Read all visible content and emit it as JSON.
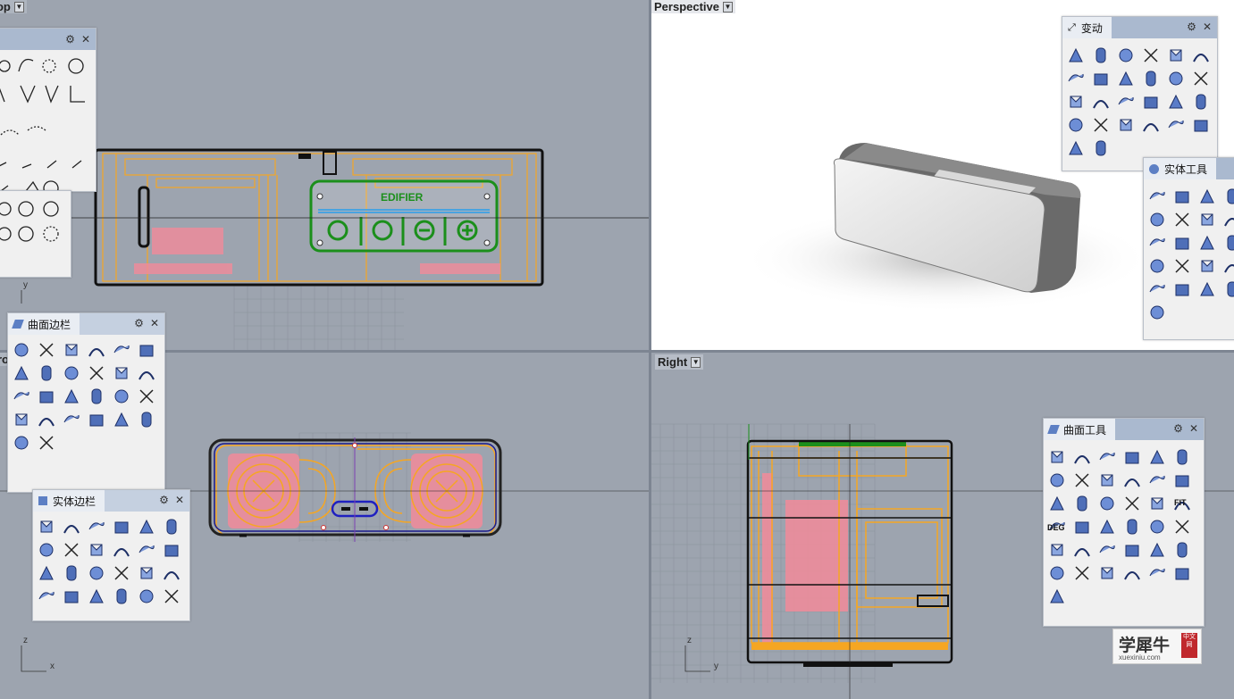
{
  "viewports": {
    "top": {
      "label": "Top"
    },
    "perspective": {
      "label": "Perspective"
    },
    "front": {
      "label": "Front"
    },
    "right": {
      "label": "Right"
    }
  },
  "axes": {
    "y": "y",
    "z": "z",
    "x": "x"
  },
  "model": {
    "brand_text": "EDIFIER"
  },
  "panels": {
    "transform": {
      "title": "变动"
    },
    "solid_tools": {
      "title": "实体工具"
    },
    "surface_sidebar": {
      "title": "曲面边栏"
    },
    "solid_sidebar": {
      "title": "实体边栏"
    },
    "surface_tools": {
      "title": "曲面工具",
      "badge_fit": "FIT",
      "badge_deg": "DEG"
    }
  },
  "watermark": {
    "cn": "学犀牛",
    "en": "xuexiniu.com",
    "seal": "中文网"
  },
  "colors": {
    "wire": "#f5a623",
    "solid": "#1a1a1a",
    "accent": "#1b8f1b",
    "pink": "#f28b9a",
    "selected_blue": "#2020c0"
  }
}
